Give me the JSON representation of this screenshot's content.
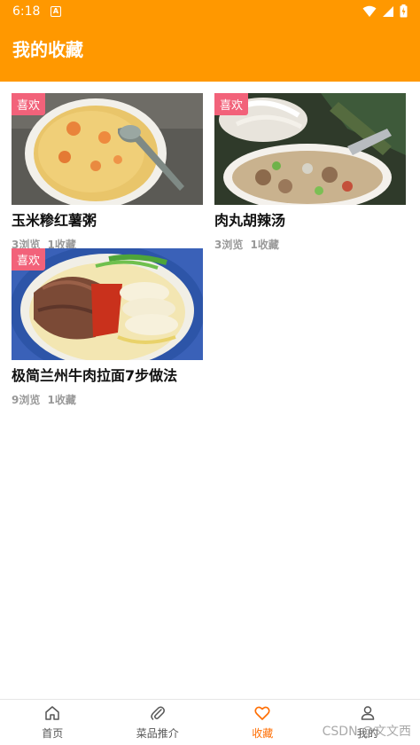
{
  "status_bar": {
    "time": "6:18",
    "notification_badge": "A"
  },
  "app_bar": {
    "title": "我的收藏",
    "color": "#ff9800"
  },
  "favorites": [
    {
      "badge": "喜欢",
      "title": "玉米糁红薯粥",
      "views": "3浏览",
      "collects": "1收藏"
    },
    {
      "badge": "喜欢",
      "title": "肉丸胡辣汤",
      "views": "3浏览",
      "collects": "1收藏"
    },
    {
      "badge": "喜欢",
      "title": "极简兰州牛肉拉面7步做法",
      "views": "9浏览",
      "collects": "1收藏"
    }
  ],
  "bottom_nav": {
    "items": [
      {
        "label": "首页",
        "icon": "home-icon"
      },
      {
        "label": "菜品推介",
        "icon": "paperclip-icon"
      },
      {
        "label": "收藏",
        "icon": "heart-icon",
        "active": true
      },
      {
        "label": "我的",
        "icon": "user-icon"
      }
    ],
    "active_color": "#ff6d00"
  },
  "watermark": "CSDN @文文西"
}
